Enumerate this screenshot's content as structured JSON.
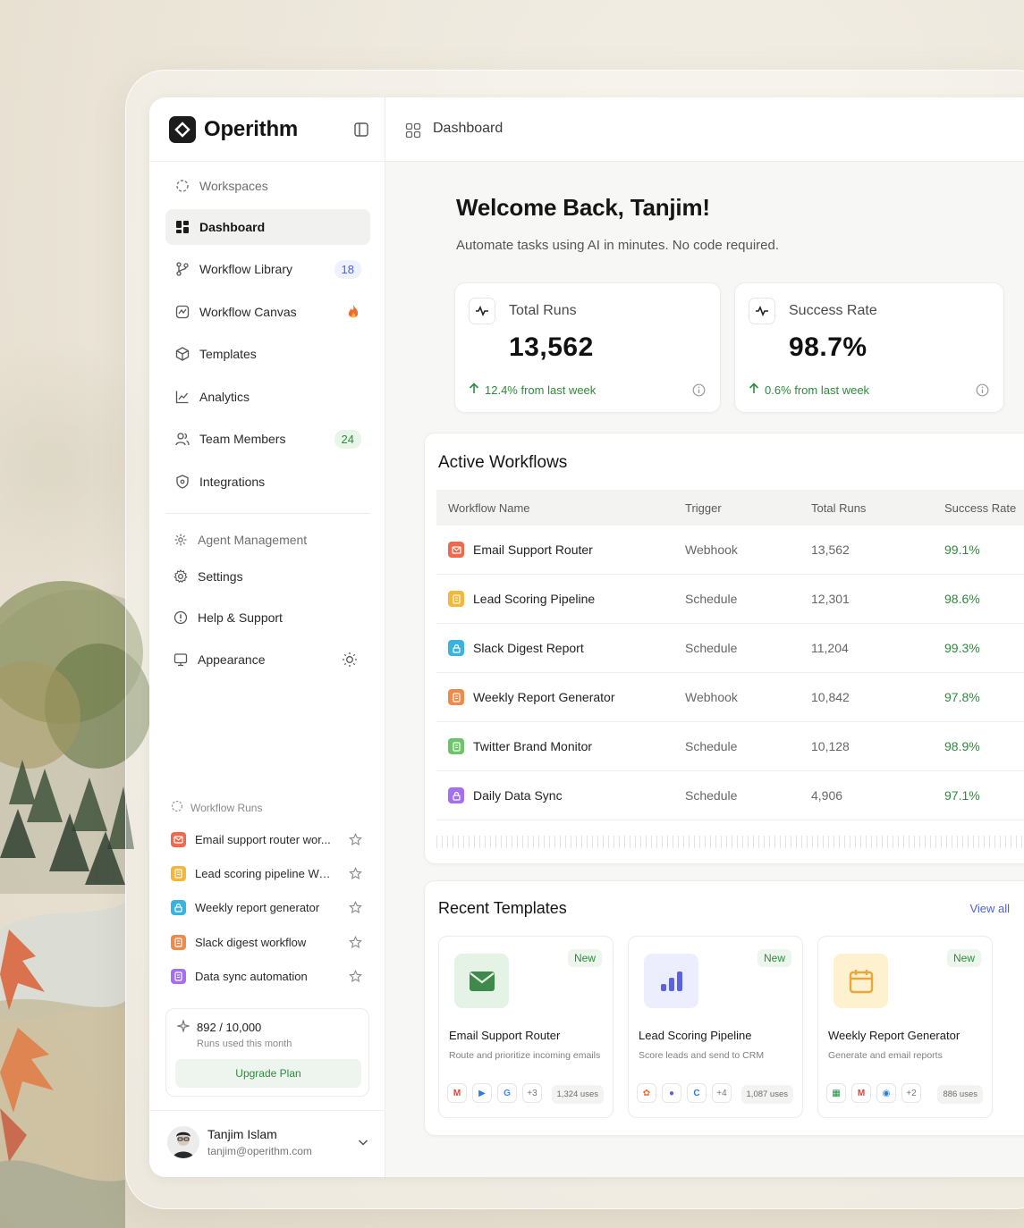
{
  "brand": {
    "name": "Operithm"
  },
  "sidebar": {
    "items": [
      {
        "label": "Workspaces"
      },
      {
        "label": "Dashboard"
      },
      {
        "label": "Workflow Library",
        "badge": "18"
      },
      {
        "label": "Workflow Canvas"
      },
      {
        "label": "Templates"
      },
      {
        "label": "Analytics"
      },
      {
        "label": "Team Members",
        "badge": "24"
      },
      {
        "label": "Integrations"
      },
      {
        "label": "Agent Management"
      },
      {
        "label": "Settings"
      },
      {
        "label": "Help & Support"
      },
      {
        "label": "Appearance"
      }
    ],
    "runs_header": "Workflow Runs",
    "runs": [
      {
        "label": "Email support router wor...",
        "color": "#ef6a4c"
      },
      {
        "label": "Lead scoring pipeline Wo...",
        "color": "#f4b73a"
      },
      {
        "label": "Weekly report generator",
        "color": "#3bb3e0"
      },
      {
        "label": "Slack digest workflow",
        "color": "#f08a4b"
      },
      {
        "label": "Data sync automation",
        "color": "#a66ef0"
      }
    ],
    "usage": {
      "count": "892 / 10,000",
      "sub": "Runs used this month",
      "button": "Upgrade Plan",
      "fraction": 0.0892
    },
    "user": {
      "name": "Tanjim Islam",
      "email": "tanjim@operithm.com"
    }
  },
  "topbar": {
    "crumb": "Dashboard"
  },
  "main": {
    "welcome": "Welcome Back, Tanjim!",
    "tagline": "Automate tasks using AI in minutes. No code required.",
    "stats": [
      {
        "title": "Total Runs",
        "value": "13,562",
        "change": "12.4% from last week"
      },
      {
        "title": "Success Rate",
        "value": "98.7%",
        "change": "0.6% from last week"
      }
    ],
    "workflows": {
      "title": "Active Workflows",
      "columns": [
        "Workflow Name",
        "Trigger",
        "Total Runs",
        "Success Rate"
      ],
      "rows": [
        {
          "name": "Email Support Router",
          "trigger": "Webhook",
          "runs": "13,562",
          "rate": "99.1%",
          "color": "#ef6a4c"
        },
        {
          "name": "Lead Scoring Pipeline",
          "trigger": "Schedule",
          "runs": "12,301",
          "rate": "98.6%",
          "color": "#f4b73a"
        },
        {
          "name": "Slack Digest Report",
          "trigger": "Schedule",
          "runs": "11,204",
          "rate": "99.3%",
          "color": "#3bb3e0"
        },
        {
          "name": "Weekly Report Generator",
          "trigger": "Webhook",
          "runs": "10,842",
          "rate": "97.8%",
          "color": "#f08a4b"
        },
        {
          "name": "Twitter Brand Monitor",
          "trigger": "Schedule",
          "runs": "10,128",
          "rate": "98.9%",
          "color": "#6cc46b"
        },
        {
          "name": "Daily Data Sync",
          "trigger": "Schedule",
          "runs": "4,906",
          "rate": "97.1%",
          "color": "#a66ef0"
        }
      ]
    },
    "templates": {
      "title": "Recent Templates",
      "view_all": "View all",
      "cards": [
        {
          "name": "Email Support Router",
          "desc": "Route and prioritize incoming emails",
          "badge": "New",
          "more": "+3",
          "uses": "1,324 uses",
          "icon": "envelope-icon",
          "color": "#e5f3e6"
        },
        {
          "name": "Lead Scoring Pipeline",
          "desc": "Score leads and send to CRM",
          "badge": "New",
          "more": "+4",
          "uses": "1,087 uses",
          "icon": "bar-chart-icon",
          "color": "#eceefe"
        },
        {
          "name": "Weekly Report Generator",
          "desc": "Generate and email reports",
          "badge": "New",
          "more": "+2",
          "uses": "886 uses",
          "icon": "calendar-icon",
          "color": "#fdf1cf"
        }
      ]
    }
  }
}
